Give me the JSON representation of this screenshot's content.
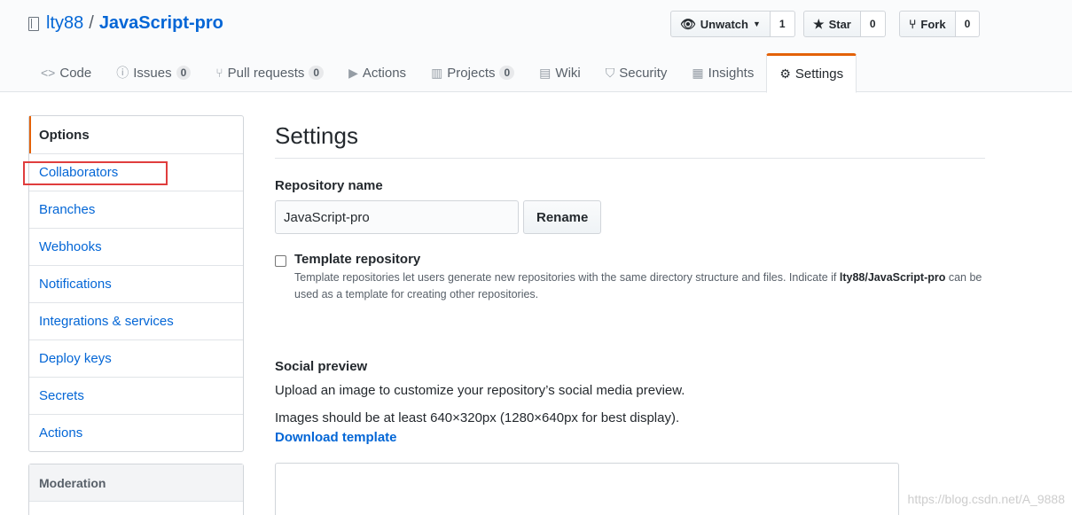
{
  "repo": {
    "owner": "lty88",
    "separator": "/",
    "name": "JavaScript-pro"
  },
  "actions": {
    "watch": {
      "icon": "eye-icon",
      "label": "Unwatch",
      "count": "1"
    },
    "star": {
      "icon": "star-icon",
      "label": "Star",
      "count": "0"
    },
    "fork": {
      "icon": "fork-icon",
      "label": "Fork",
      "count": "0"
    }
  },
  "tabs": [
    {
      "label": "Code",
      "icon": "code-icon"
    },
    {
      "label": "Issues",
      "icon": "issue-icon",
      "count": "0"
    },
    {
      "label": "Pull requests",
      "icon": "pull-request-icon",
      "count": "0"
    },
    {
      "label": "Actions",
      "icon": "play-icon"
    },
    {
      "label": "Projects",
      "icon": "project-icon",
      "count": "0"
    },
    {
      "label": "Wiki",
      "icon": "book-icon"
    },
    {
      "label": "Security",
      "icon": "shield-icon"
    },
    {
      "label": "Insights",
      "icon": "graph-icon"
    },
    {
      "label": "Settings",
      "icon": "gear-icon",
      "selected": true
    }
  ],
  "sidebar": {
    "items": [
      {
        "label": "Options",
        "selected": true
      },
      {
        "label": "Collaborators"
      },
      {
        "label": "Branches"
      },
      {
        "label": "Webhooks"
      },
      {
        "label": "Notifications"
      },
      {
        "label": "Integrations & services"
      },
      {
        "label": "Deploy keys"
      },
      {
        "label": "Secrets"
      },
      {
        "label": "Actions"
      }
    ],
    "moderation": "Moderation"
  },
  "main": {
    "title": "Settings",
    "repo_name_label": "Repository name",
    "repo_name_value": "JavaScript-pro",
    "rename_label": "Rename",
    "template": {
      "title": "Template repository",
      "note_before": "Template repositories let users generate new repositories with the same directory structure and files. Indicate if ",
      "note_repo": "lty88/JavaScript-pro",
      "note_after": " can be used as a template for creating other repositories."
    },
    "social": {
      "title": "Social preview",
      "line1": "Upload an image to customize your repository’s social media preview.",
      "line2": "Images should be at least 640×320px (1280×640px for best display).",
      "download": "Download template"
    }
  },
  "watermark": "https://blog.csdn.net/A_9888",
  "colors": {
    "accent": "#e36209",
    "link": "#0366d6",
    "highlight": "#e03d3d"
  }
}
